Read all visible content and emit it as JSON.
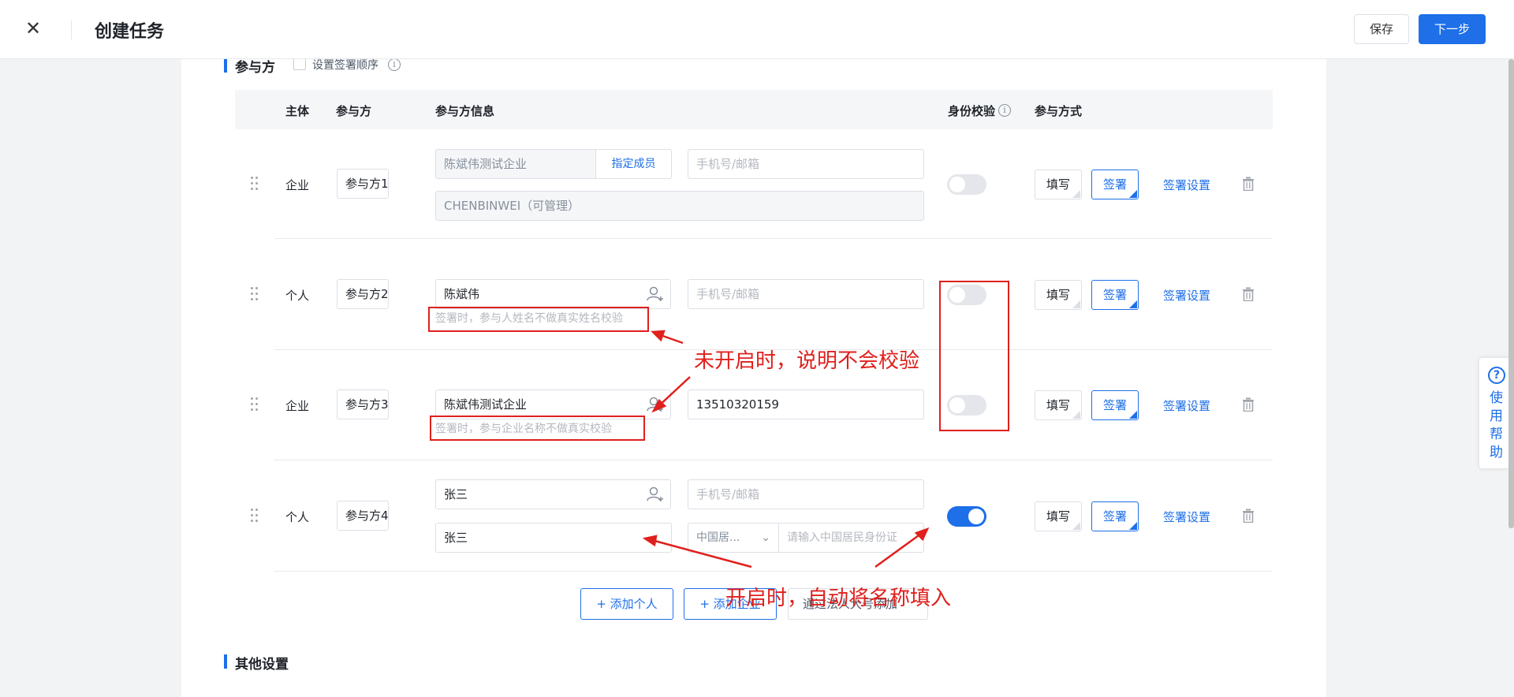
{
  "header": {
    "title": "创建任务",
    "save_label": "保存",
    "next_label": "下一步",
    "close_icon": "close-icon"
  },
  "participants_section": {
    "title": "参与方",
    "order_checkbox_label": "设置签署顺序",
    "columns": [
      "主体",
      "参与方",
      "参与方信息",
      "身份校验",
      "参与方式"
    ],
    "rows": [
      {
        "subject": "企业",
        "party": "参与方1",
        "info_name": "陈斌伟测试企业",
        "info_action": "指定成员",
        "contact_placeholder": "手机号/邮箱",
        "member": "CHENBINWEI（可管理）",
        "verify_on": false,
        "mode_fill": "填写",
        "mode_sign": "签署",
        "settings": "签署设置"
      },
      {
        "subject": "个人",
        "party": "参与方2",
        "info_name": "陈斌伟",
        "contact_placeholder": "手机号/邮箱",
        "hint": "签署时，参与人姓名不做真实姓名校验",
        "verify_on": false,
        "mode_fill": "填写",
        "mode_sign": "签署",
        "settings": "签署设置"
      },
      {
        "subject": "企业",
        "party": "参与方3",
        "info_name": "陈斌伟测试企业",
        "contact": "13510320159",
        "hint": "签署时，参与企业名称不做真实校验",
        "verify_on": false,
        "mode_fill": "填写",
        "mode_sign": "签署",
        "settings": "签署设置"
      },
      {
        "subject": "个人",
        "party": "参与方4",
        "info_name": "张三",
        "contact_placeholder": "手机号/邮箱",
        "real_name": "张三",
        "id_type": "中国居...",
        "id_placeholder": "请输入中国居民身份证",
        "verify_on": true,
        "mode_fill": "填写",
        "mode_sign": "签署",
        "settings": "签署设置"
      }
    ],
    "add_person": "+ 添加个人",
    "add_company": "+ 添加企业",
    "add_by_contacts": "通过法人大号添加"
  },
  "other_section": {
    "title": "其他设置"
  },
  "annotations": {
    "off_note": "未开启时，说明不会校验",
    "on_note": "开启时，自动将名称填入"
  },
  "help": {
    "label": "使用帮助"
  },
  "colors": {
    "primary": "#1e6fe8",
    "annotation": "#e0201d"
  }
}
